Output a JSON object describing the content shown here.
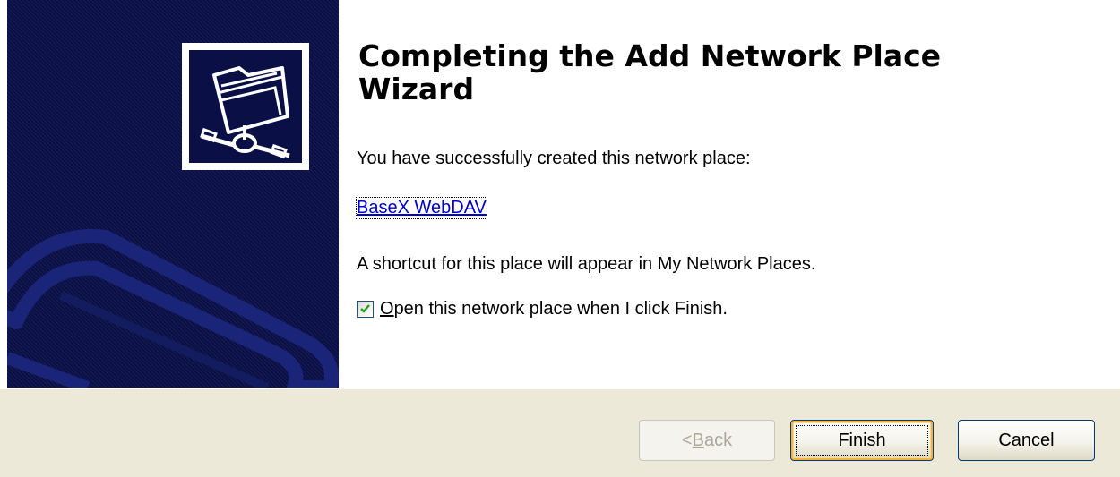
{
  "wizard": {
    "title": "Completing the Add Network Place Wizard",
    "success_message": "You have successfully created this network place:",
    "place_name": "BaseX WebDAV",
    "shortcut_message": "A shortcut for this place will appear in My Network Places.",
    "open_checkbox": {
      "checked": true,
      "mnemonic": "O",
      "label_rest": "pen this network place when I click Finish."
    }
  },
  "buttons": {
    "back": {
      "prefix": "< ",
      "mnemonic": "B",
      "rest": "ack",
      "enabled": false
    },
    "finish": {
      "label": "Finish",
      "default": true
    },
    "cancel": {
      "label": "Cancel"
    }
  },
  "icons": {
    "logo": "network-folder-icon",
    "checkbox": "checkmark-icon"
  },
  "colors": {
    "side_panel": "#0a1046",
    "panel_shapes": "#1a2478",
    "footer": "#ece9d8",
    "link": "#0000cc",
    "finish_highlight": "#f8b33e"
  }
}
